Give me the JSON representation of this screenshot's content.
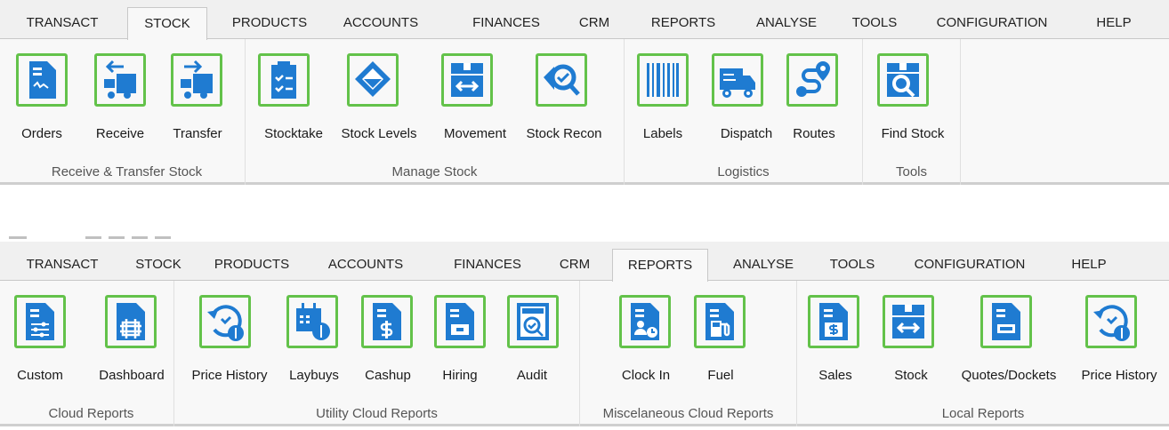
{
  "top": {
    "tabs": [
      "TRANSACT",
      "STOCK",
      "PRODUCTS",
      "ACCOUNTS",
      "FINANCES",
      "CRM",
      "REPORTS",
      "ANALYSE",
      "TOOLS",
      "CONFIGURATION",
      "HELP"
    ],
    "active_tab": "STOCK",
    "groups": [
      {
        "label": "Receive & Transfer Stock",
        "buttons": [
          {
            "label": "Orders",
            "icon": "document-icon"
          },
          {
            "label": "Receive",
            "icon": "receive-icon"
          },
          {
            "label": "Transfer",
            "icon": "transfer-icon"
          }
        ]
      },
      {
        "label": "Manage Stock",
        "buttons": [
          {
            "label": "Stocktake",
            "icon": "clipboard-check-icon"
          },
          {
            "label": "Stock Levels",
            "icon": "bucket-icon"
          },
          {
            "label": "Movement",
            "icon": "box-arrows-icon"
          },
          {
            "label": "Stock Recon",
            "icon": "magnify-check-icon"
          }
        ]
      },
      {
        "label": "Logistics",
        "buttons": [
          {
            "label": "Labels",
            "icon": "barcode-icon"
          },
          {
            "label": "Dispatch",
            "icon": "truck-icon"
          },
          {
            "label": "Routes",
            "icon": "route-icon"
          }
        ]
      },
      {
        "label": "Tools",
        "buttons": [
          {
            "label": "Find Stock",
            "icon": "box-search-icon"
          }
        ]
      }
    ]
  },
  "bottom": {
    "tabs": [
      "TRANSACT",
      "STOCK",
      "PRODUCTS",
      "ACCOUNTS",
      "FINANCES",
      "CRM",
      "REPORTS",
      "ANALYSE",
      "TOOLS",
      "CONFIGURATION",
      "HELP"
    ],
    "active_tab": "REPORTS",
    "groups": [
      {
        "label": "Cloud Reports",
        "buttons": [
          {
            "label": "Custom",
            "icon": "report-sliders-icon"
          },
          {
            "label": "Dashboard",
            "icon": "report-frame-icon"
          }
        ]
      },
      {
        "label": "Utility Cloud Reports",
        "buttons": [
          {
            "label": "Price History",
            "icon": "price-history-icon"
          },
          {
            "label": "Laybuys",
            "icon": "calendar-dollar-icon"
          },
          {
            "label": "Cashup",
            "icon": "report-dollar-icon"
          },
          {
            "label": "Hiring",
            "icon": "report-folder-icon"
          },
          {
            "label": "Audit",
            "icon": "audit-icon"
          }
        ]
      },
      {
        "label": "Miscelaneous Cloud Reports",
        "buttons": [
          {
            "label": "Clock In",
            "icon": "report-clock-icon"
          },
          {
            "label": "Fuel",
            "icon": "report-fuel-icon"
          }
        ]
      },
      {
        "label": "Local Reports",
        "buttons": [
          {
            "label": "Sales",
            "icon": "report-sales-icon"
          },
          {
            "label": "Stock",
            "icon": "box-arrows-icon"
          },
          {
            "label": "Quotes/Dockets",
            "icon": "report-quote-icon"
          },
          {
            "label": "Price History",
            "icon": "price-history-icon"
          }
        ]
      }
    ]
  },
  "icon_color": "#1f7bd1",
  "highlight_color": "#63c24a"
}
